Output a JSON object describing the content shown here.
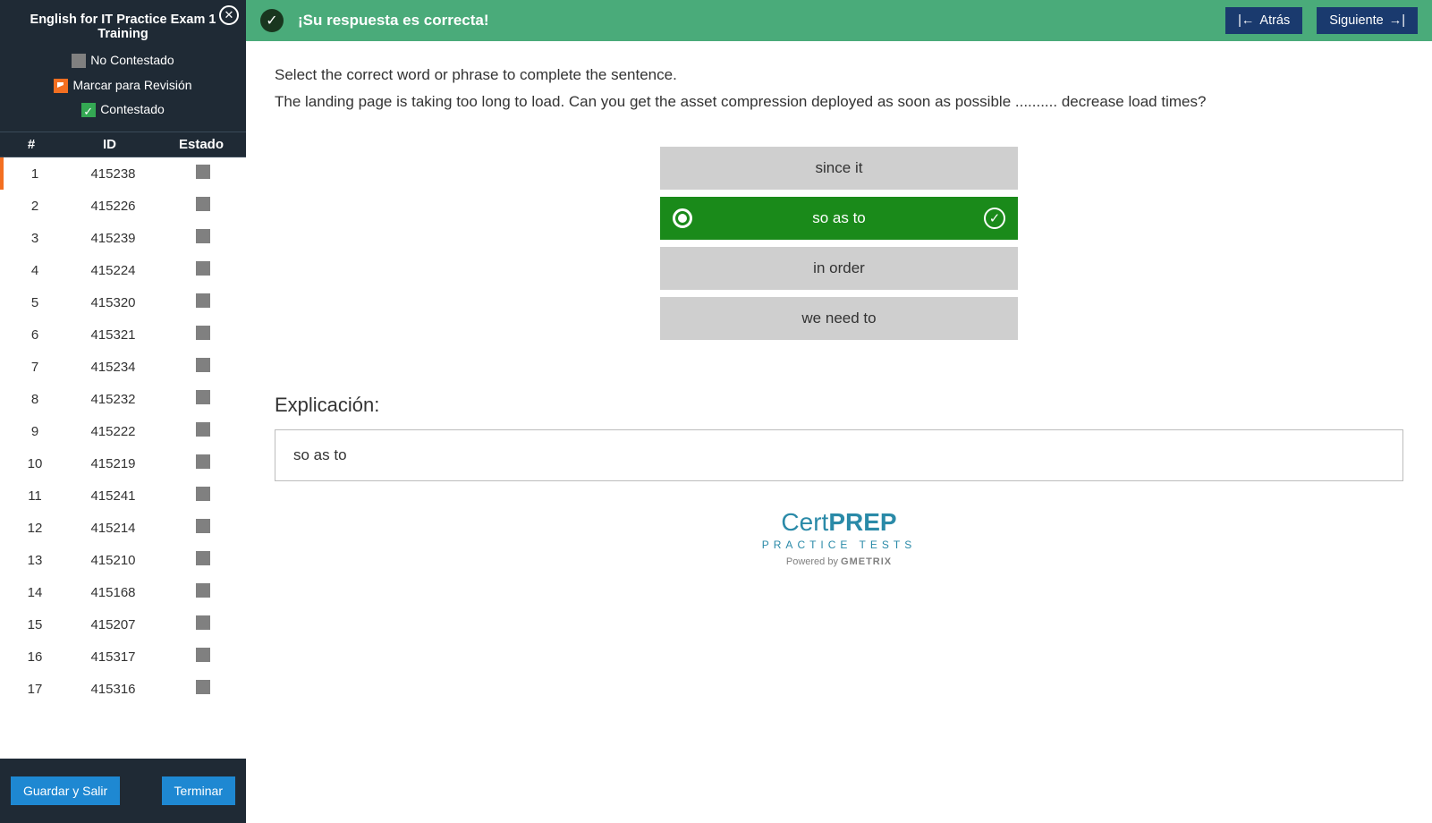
{
  "sidebar": {
    "close_icon": "✕",
    "exam_title": "English for IT Practice Exam 1 Training",
    "legend": {
      "no_contestado": "No Contestado",
      "marcar": "Marcar para Revisión",
      "contestado": "Contestado"
    },
    "headers": {
      "num": "#",
      "id": "ID",
      "estado": "Estado"
    },
    "questions": [
      {
        "n": 1,
        "id": "415238",
        "selected": true
      },
      {
        "n": 2,
        "id": "415226"
      },
      {
        "n": 3,
        "id": "415239"
      },
      {
        "n": 4,
        "id": "415224"
      },
      {
        "n": 5,
        "id": "415320"
      },
      {
        "n": 6,
        "id": "415321"
      },
      {
        "n": 7,
        "id": "415234"
      },
      {
        "n": 8,
        "id": "415232"
      },
      {
        "n": 9,
        "id": "415222"
      },
      {
        "n": 10,
        "id": "415219"
      },
      {
        "n": 11,
        "id": "415241"
      },
      {
        "n": 12,
        "id": "415214"
      },
      {
        "n": 13,
        "id": "415210"
      },
      {
        "n": 14,
        "id": "415168"
      },
      {
        "n": 15,
        "id": "415207"
      },
      {
        "n": 16,
        "id": "415317"
      },
      {
        "n": 17,
        "id": "415316"
      }
    ],
    "footer": {
      "save": "Guardar y Salir",
      "finish": "Terminar"
    }
  },
  "banner": {
    "title": "¡Su respuesta es correcta!",
    "back": "Atrás",
    "next": "Siguiente"
  },
  "question": {
    "prompt": "Select the correct word or phrase to complete the sentence.",
    "sentence": "The landing page is taking too long to load. Can you get the asset compression deployed as soon as possible .......... decrease load times?",
    "options": [
      {
        "text": "since it",
        "selected": false
      },
      {
        "text": "so as to",
        "selected": true
      },
      {
        "text": "in order",
        "selected": false
      },
      {
        "text": "we need to",
        "selected": false
      }
    ]
  },
  "explanation": {
    "title": "Explicación:",
    "text": "so as to"
  },
  "logo": {
    "line1a": "Cert",
    "line1b": "PREP",
    "sub": "PRACTICE TESTS",
    "powered": "Powered by",
    "gmetrix": "GMETRIX"
  }
}
